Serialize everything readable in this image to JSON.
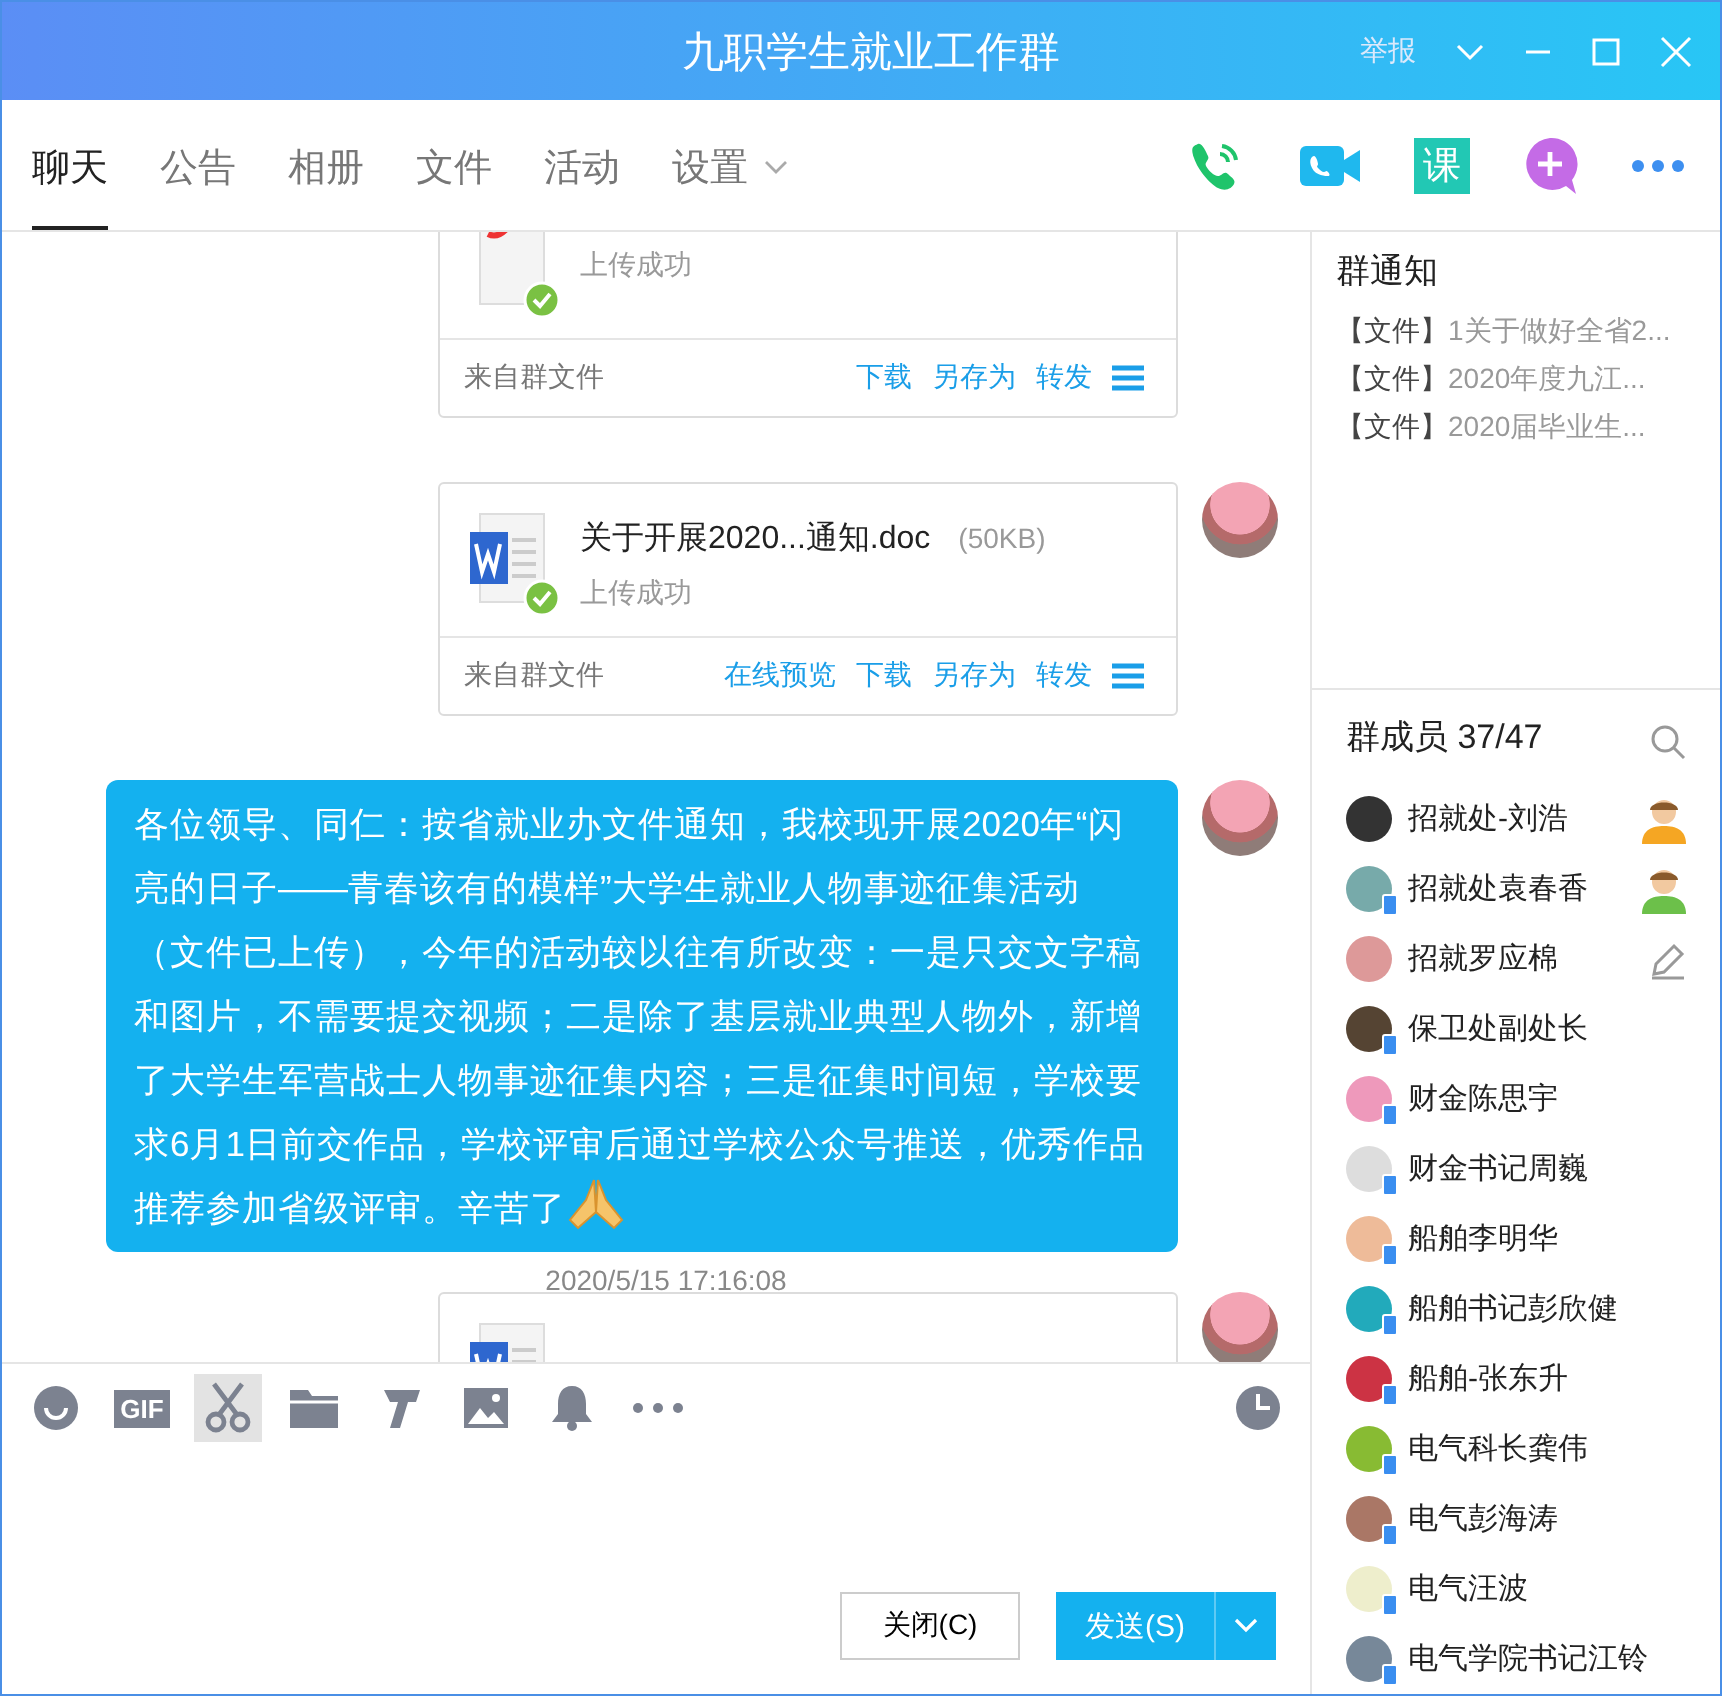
{
  "window": {
    "title": "九职学生就业工作群",
    "report": "举报"
  },
  "tabs": [
    {
      "label": "聊天",
      "selected": true,
      "menu": false
    },
    {
      "label": "公告",
      "selected": false,
      "menu": false
    },
    {
      "label": "相册",
      "selected": false,
      "menu": false
    },
    {
      "label": "文件",
      "selected": false,
      "menu": false
    },
    {
      "label": "活动",
      "selected": false,
      "menu": false
    },
    {
      "label": "设置",
      "selected": false,
      "menu": true
    }
  ],
  "header_actions": [
    {
      "kind": "voice-call"
    },
    {
      "kind": "video-call"
    },
    {
      "kind": "course",
      "label": "课"
    },
    {
      "kind": "add"
    },
    {
      "kind": "more"
    }
  ],
  "messages": [
    {
      "kind": "pdf-file",
      "status": "上传成功",
      "source": "来自群文件",
      "actions": [
        "下载",
        "另存为",
        "转发"
      ],
      "avatar": false
    },
    {
      "kind": "word-file",
      "name": "关于开展2020...通知.doc",
      "size": "(50KB)",
      "status": "上传成功",
      "source": "来自群文件",
      "actions": [
        "在线预览",
        "下载",
        "另存为",
        "转发"
      ],
      "avatar": true
    },
    {
      "kind": "text",
      "text": "各位领导、同仁：按省就业办文件通知，我校现开展2020年“闪亮的日子——青春该有的模样”大学生就业人物事迹征集活动（文件已上传），今年的活动较以往有所改变：一是只交文字稿和图片，不需要提交视频；二是除了基层就业典型人物外，新增了大学生军营战士人物事迹征集内容；三是征集时间短，学校要求6月1日前交作品，学校评审后通过学校公众号推送，优秀作品推荐参加省级评审。辛苦了",
      "avatar": true
    },
    {
      "kind": "timestamp",
      "text": "2020/5/15 17:16:08"
    },
    {
      "kind": "word-file",
      "avatar": true
    }
  ],
  "tools": [
    {
      "kind": "emoji",
      "selected": false
    },
    {
      "kind": "gif",
      "label": "GIF",
      "selected": false
    },
    {
      "kind": "scissors",
      "selected": true
    },
    {
      "kind": "folder",
      "selected": false
    },
    {
      "kind": "font",
      "selected": false
    },
    {
      "kind": "image",
      "selected": false
    },
    {
      "kind": "bell",
      "selected": false
    },
    {
      "kind": "more",
      "selected": false
    }
  ],
  "buttons": {
    "close": "关闭(C)",
    "send": "发送(S)"
  },
  "notices": {
    "title": "群通知",
    "items": [
      {
        "tag": "【文件】",
        "title": "1关于做好全省2..."
      },
      {
        "tag": "【文件】",
        "title": "2020年度九江..."
      },
      {
        "tag": "【文件】",
        "title": "2020届毕业生..."
      }
    ]
  },
  "members": {
    "title": "群成员 37/47",
    "items": [
      {
        "name": "招就处-刘浩",
        "kind": "owner",
        "mobile": false
      },
      {
        "name": "招就处袁春香",
        "kind": "admin",
        "mobile": true
      },
      {
        "name": "招就罗应棉",
        "kind": "editor",
        "mobile": false
      },
      {
        "name": "保卫处副处长",
        "mobile": true
      },
      {
        "name": "财金陈思宇",
        "mobile": true
      },
      {
        "name": "财金书记周巍",
        "mobile": true
      },
      {
        "name": "船舶李明华",
        "mobile": true
      },
      {
        "name": "船舶书记彭欣健",
        "mobile": true
      },
      {
        "name": "船舶-张东升",
        "mobile": true
      },
      {
        "name": "电气科长龚伟",
        "mobile": true
      },
      {
        "name": "电气彭海涛",
        "mobile": true
      },
      {
        "name": "电气汪波",
        "mobile": true
      },
      {
        "name": "电气学院书记江铃",
        "mobile": true
      }
    ]
  }
}
